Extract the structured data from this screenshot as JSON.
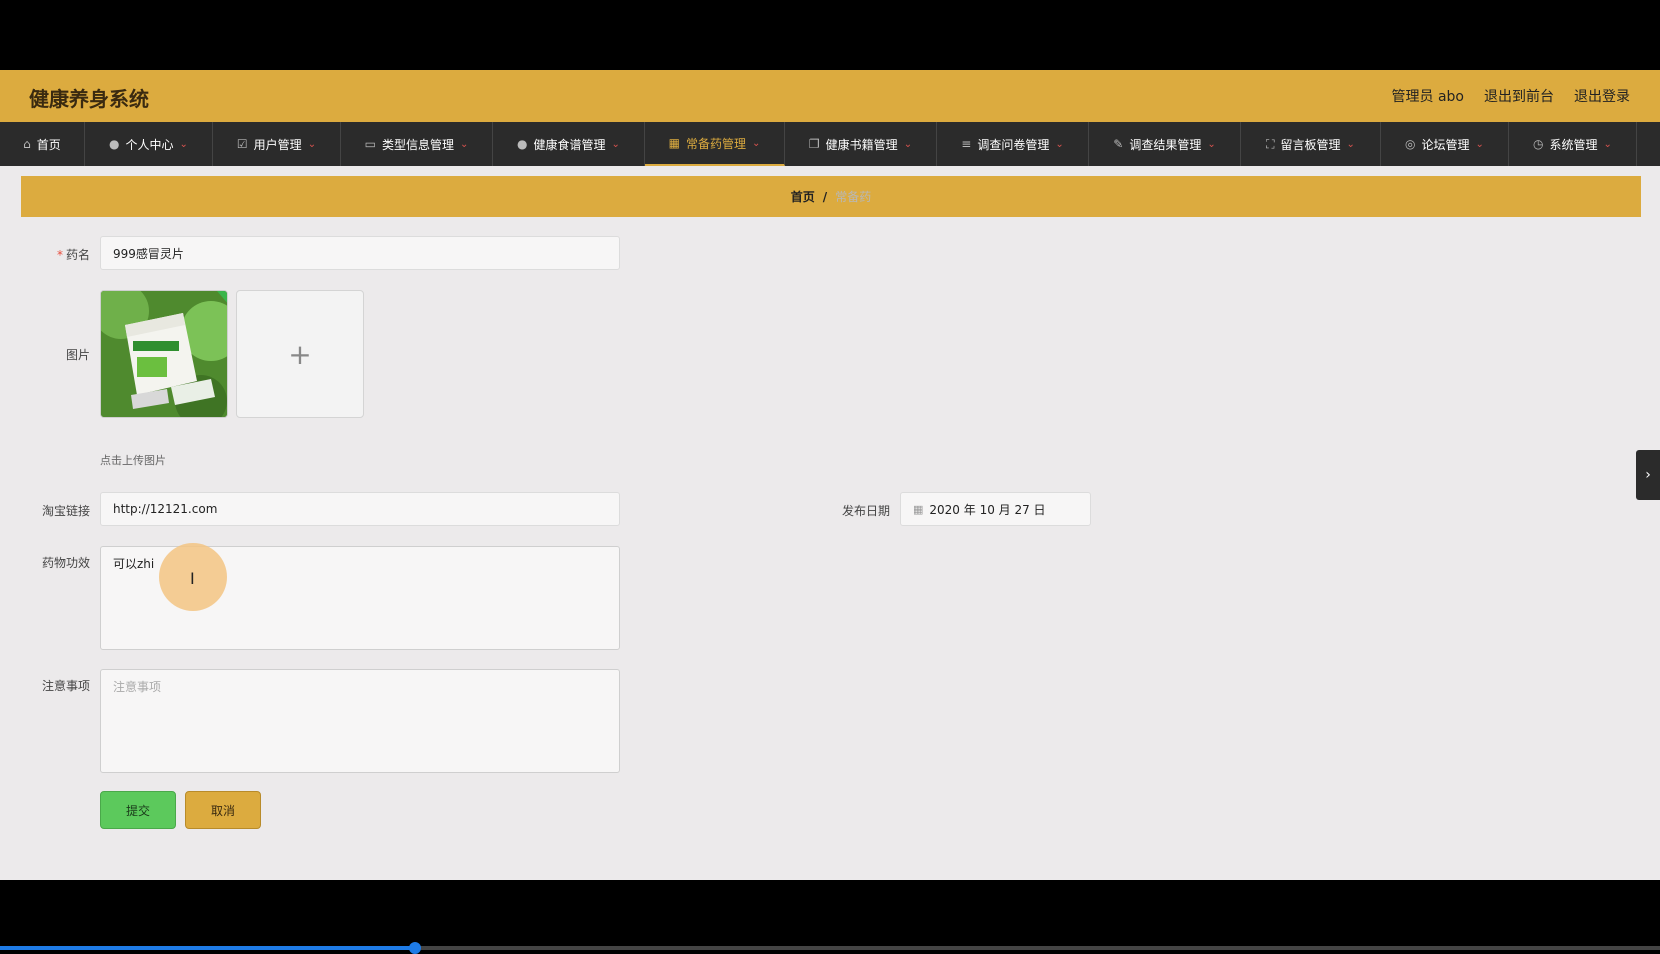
{
  "app": {
    "title": "健康养身系统",
    "header_links": [
      "管理员 abo",
      "退出到前台",
      "退出登录"
    ]
  },
  "nav": {
    "items": [
      {
        "label": "首页",
        "icon": "home-icon",
        "chevron": false,
        "active": false
      },
      {
        "label": "个人中心",
        "icon": "user-icon",
        "chevron": true,
        "active": false
      },
      {
        "label": "用户管理",
        "icon": "checkbox-icon",
        "chevron": true,
        "active": false
      },
      {
        "label": "类型信息管理",
        "icon": "card-icon",
        "chevron": true,
        "active": false
      },
      {
        "label": "健康食谱管理",
        "icon": "user-icon",
        "chevron": true,
        "active": false
      },
      {
        "label": "常备药管理",
        "icon": "grid-icon",
        "chevron": true,
        "active": true
      },
      {
        "label": "健康书籍管理",
        "icon": "copy-icon",
        "chevron": true,
        "active": false
      },
      {
        "label": "调查问卷管理",
        "icon": "list-icon",
        "chevron": true,
        "active": false
      },
      {
        "label": "调查结果管理",
        "icon": "pen-icon",
        "chevron": true,
        "active": false
      },
      {
        "label": "留言板管理",
        "icon": "frame-icon",
        "chevron": true,
        "active": false
      },
      {
        "label": "论坛管理",
        "icon": "circle-icon",
        "chevron": true,
        "active": false
      },
      {
        "label": "系统管理",
        "icon": "clock-icon",
        "chevron": true,
        "active": false
      }
    ]
  },
  "breadcrumb": {
    "home": "首页",
    "separator": "/",
    "current": "常备药"
  },
  "form": {
    "name": {
      "required_mark": "*",
      "label": "药名",
      "value": "999感冒灵片"
    },
    "image": {
      "label": "图片",
      "upload_plus": "+",
      "hint": "点击上传图片"
    },
    "taobao": {
      "label": "淘宝链接",
      "value": "http://12121.com"
    },
    "publish_date": {
      "label": "发布日期",
      "value": "2020 年 10 月 27 日"
    },
    "efficacy": {
      "label": "药物功效",
      "value": "可以zhi"
    },
    "notes": {
      "label": "注意事项",
      "placeholder": "注意事项"
    },
    "submit_label": "提交",
    "cancel_label": "取消"
  },
  "colors": {
    "accent": "#dcab3f",
    "nav_bg": "#2b2b2b",
    "submit": "#5cc95c",
    "required": "#e74c3c"
  },
  "video_progress": 0.25
}
